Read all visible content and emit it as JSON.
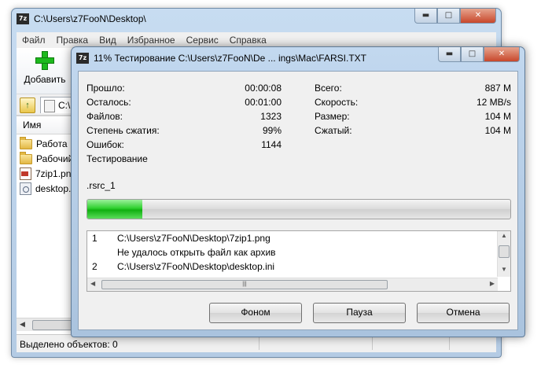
{
  "main_window": {
    "title": "C:\\Users\\z7FooN\\Desktop\\",
    "app_icon_text": "7z",
    "controls": {
      "minimize": "▬",
      "maximize": "□",
      "close": "✕"
    },
    "menu": [
      "Файл",
      "Правка",
      "Вид",
      "Избранное",
      "Сервис",
      "Справка"
    ],
    "toolbar": {
      "add_label": "Добавить"
    },
    "address": {
      "path": "C:\\"
    },
    "columns": {
      "name": "Имя"
    },
    "files": [
      {
        "name": "Работа",
        "icon": "folder-icon"
      },
      {
        "name": "Рабочий",
        "icon": "folder-icon"
      },
      {
        "name": "7zip1.png",
        "icon": "png-file-icon"
      },
      {
        "name": "desktop.",
        "icon": "ini-file-icon"
      }
    ],
    "status": "Выделено объектов: 0"
  },
  "dialog": {
    "title": "11% Тестирование C:\\Users\\z7FooN\\De ... ings\\Mac\\FARSI.TXT",
    "app_icon_text": "7z",
    "stats_left": [
      {
        "label": "Прошло:",
        "value": "00:00:08"
      },
      {
        "label": "Осталось:",
        "value": "00:01:00"
      },
      {
        "label": "Файлов:",
        "value": "1323"
      },
      {
        "label": "Степень сжатия:",
        "value": "99%"
      },
      {
        "label": "Ошибок:",
        "value": "1144"
      }
    ],
    "stats_right": [
      {
        "label": "Всего:",
        "value": "887 M"
      },
      {
        "label": "Скорость:",
        "value": "12 MB/s"
      },
      {
        "label": "Размер:",
        "value": "104 M"
      },
      {
        "label": "Сжатый:",
        "value": "104 M"
      }
    ],
    "operation": "Тестирование",
    "current_item": ".rsrc_1",
    "progress_fraction": 0.13,
    "progress_color": "#22c422",
    "log": [
      {
        "num": "1",
        "text": "C:\\Users\\z7FooN\\Desktop\\7zip1.png"
      },
      {
        "num": "",
        "text": "Не удалось открыть файл как архив"
      },
      {
        "num": "2",
        "text": "C:\\Users\\z7FooN\\Desktop\\desktop.ini"
      }
    ],
    "buttons": {
      "background": "Фоном",
      "pause": "Пауза",
      "cancel": "Отмена"
    }
  }
}
